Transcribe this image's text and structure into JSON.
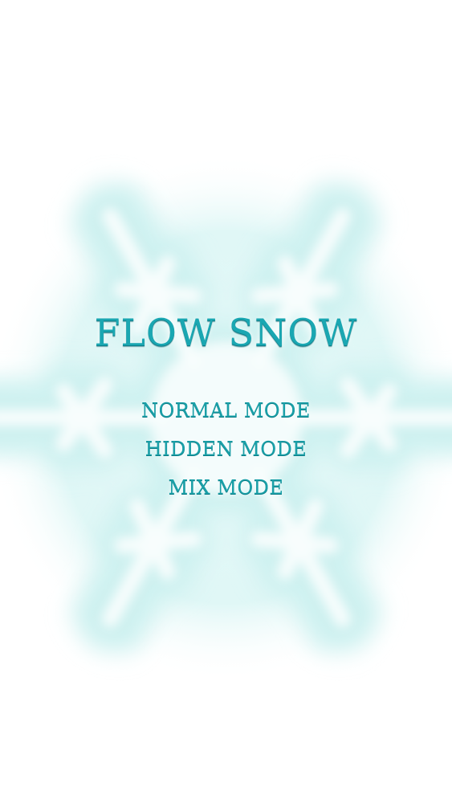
{
  "title": "FLOW SNOW",
  "menu": {
    "items": [
      {
        "label": "NORMAL MODE"
      },
      {
        "label": "HIDDEN MODE"
      },
      {
        "label": "MIX MODE"
      }
    ]
  },
  "colors": {
    "text": "#1aa7b2",
    "text_shadow": "#0b7f8a",
    "snowflake": "#d6f5f4",
    "background": "#ffffff"
  },
  "background_graphic": "snowflake-icon"
}
